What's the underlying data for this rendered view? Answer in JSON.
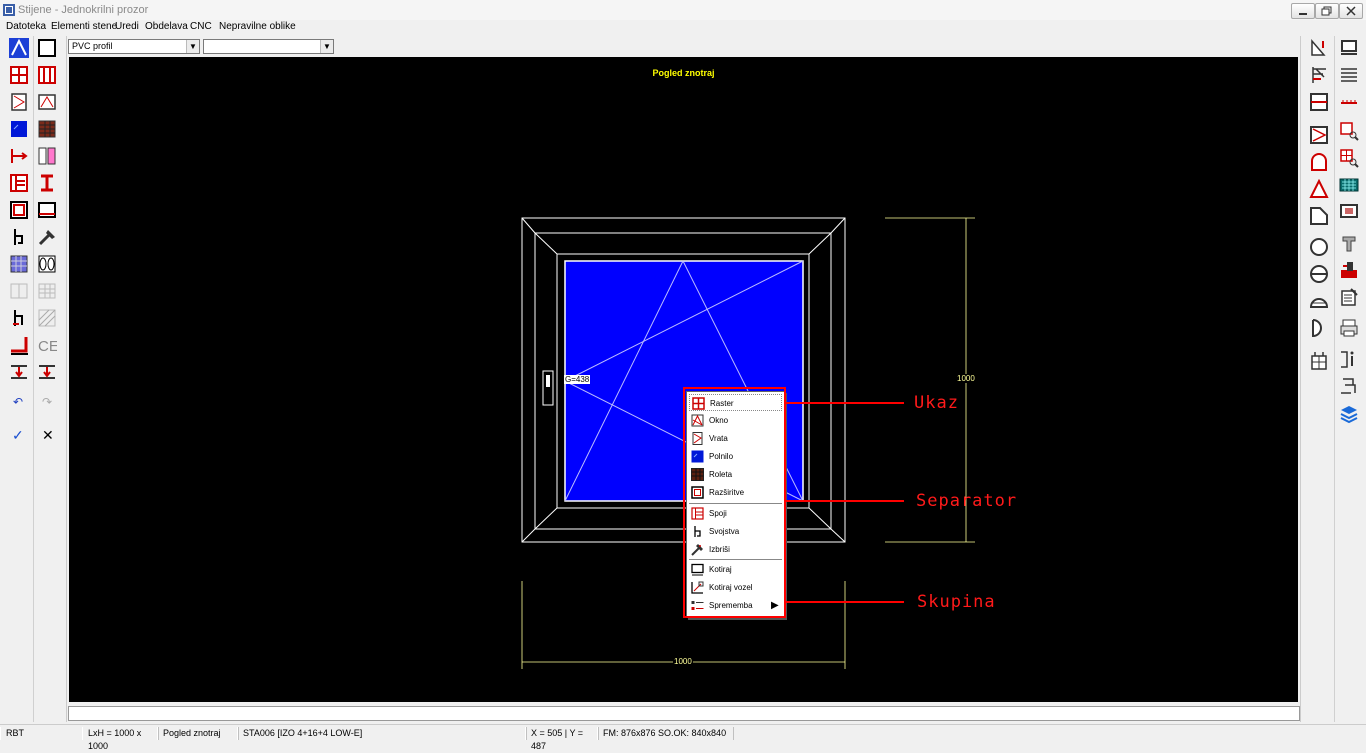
{
  "window": {
    "title": "Stijene - Jednokrilni prozor"
  },
  "menu": [
    "Datoteka",
    "Elementi stene",
    "Uredi",
    "Obdelava",
    "CNC",
    "Nepravilne oblike"
  ],
  "combos": {
    "profile": "PVC profil",
    "second": "",
    "arrow": "▼"
  },
  "canvas": {
    "view_label": "Pogled znotraj",
    "dim_width": "1000",
    "dim_height": "1000",
    "handle_label": "G=438"
  },
  "context_menu": {
    "items": [
      {
        "label": "Raster",
        "icon": "raster-icon"
      },
      {
        "label": "Okno",
        "icon": "window-icon"
      },
      {
        "label": "Vrata",
        "icon": "door-icon"
      },
      {
        "label": "Polnilo",
        "icon": "fill-icon"
      },
      {
        "label": "Roleta",
        "icon": "shutter-icon"
      },
      {
        "label": "Razširitve",
        "icon": "extension-icon"
      },
      {
        "label": "Spoji",
        "icon": "joint-icon"
      },
      {
        "label": "Svojstva",
        "icon": "properties-icon"
      },
      {
        "label": "Izbriši",
        "icon": "delete-icon"
      },
      {
        "label": "Kotiraj",
        "icon": "dimension-icon"
      },
      {
        "label": "Kotiraj vozel",
        "icon": "dimension-node-icon"
      },
      {
        "label": "Sprememba",
        "icon": "change-icon"
      }
    ],
    "submenu_arrow": "▶"
  },
  "callouts": {
    "ukaz": "Ukaz",
    "separator": "Separator",
    "skupina": "Skupina"
  },
  "status": {
    "mode": "RBT",
    "size": "LxH = 1000 x 1000",
    "view": "Pogled znotraj",
    "glass": "STA006 [IZO 4+16+4 LOW-E]",
    "coords": "X = 505 | Y = 487",
    "fm": "FM: 876x876  SO.OK: 840x840"
  },
  "toolbar_marks": {
    "undo": "↶",
    "redo": "↷",
    "ok": "✓",
    "cancel": "✕",
    "ce": "CE"
  },
  "colors": {
    "canvas": "#000000",
    "glass": "#0000ff",
    "frame": "#ffffff",
    "dimension": "#ffff99",
    "callout": "#ff0000",
    "view_label": "#ffff00"
  }
}
